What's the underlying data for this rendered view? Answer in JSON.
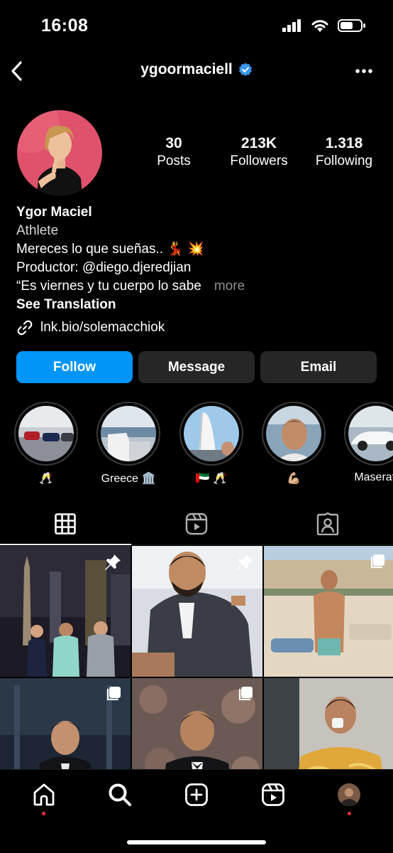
{
  "status": {
    "time": "16:08"
  },
  "profile": {
    "username": "ygoormaciell",
    "verified": true,
    "stats": [
      {
        "value": "30",
        "label": "Posts"
      },
      {
        "value": "213K",
        "label": "Followers"
      },
      {
        "value": "1.318",
        "label": "Following"
      }
    ],
    "bio": {
      "name": "Ygor Maciel",
      "category": "Athlete",
      "line1": "Mereces lo que sueñas.. 💃 💥",
      "line2": "Productor: @diego.djeredjian",
      "line3": "“Es viernes y tu cuerpo lo sabe",
      "more": "more",
      "see_translation": "See Translation",
      "link": "lnk.bio/solemacchiok"
    }
  },
  "actions": {
    "follow": "Follow",
    "message": "Message",
    "email": "Email"
  },
  "highlights": [
    {
      "label": "🥂"
    },
    {
      "label": "Greece 🏛️"
    },
    {
      "label": "🇦🇪 🥂"
    },
    {
      "label": "💪🏼"
    },
    {
      "label": "Maserati"
    }
  ],
  "colors": {
    "accent": "#0095f6",
    "button_dark": "#262626",
    "verified": "#3897f0",
    "notification_dot": "#ff3040"
  }
}
